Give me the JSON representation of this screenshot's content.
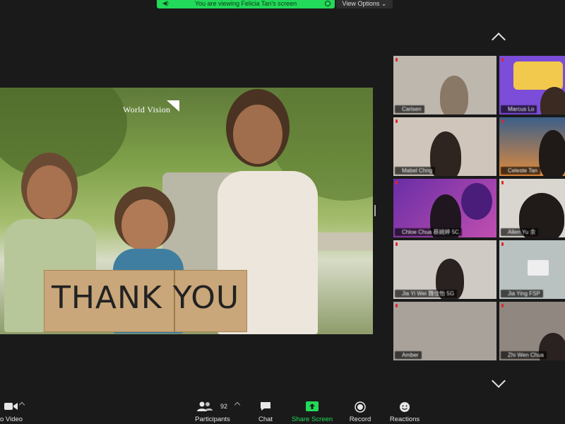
{
  "banner": {
    "text": "You are viewing Felicia Tan's screen",
    "options_label": "View Options"
  },
  "shared_screen": {
    "logo_text": "World Vision",
    "sign_text": "THANK YOU"
  },
  "gallery": {
    "tiles": [
      {
        "name": "Carisen"
      },
      {
        "name": "Marcus Lo"
      },
      {
        "name": "Mabel Chng"
      },
      {
        "name": "Celeste Tan"
      },
      {
        "name": "Chloe Chua 蔡婉婷 5C"
      },
      {
        "name": "Allen Yu 余"
      },
      {
        "name": "Jia Yi Wei 魏佳怡 5G"
      },
      {
        "name": "Jia Ying FSP"
      },
      {
        "name": "Amber"
      },
      {
        "name": "Zhi Wen Chua"
      }
    ]
  },
  "toolbar": {
    "video_label": "o Video",
    "participants_label": "Participants",
    "participants_count": "92",
    "chat_label": "Chat",
    "share_label": "Share Screen",
    "record_label": "Record",
    "reactions_label": "Reactions"
  },
  "colors": {
    "share_green": "#23d959",
    "mic_muted": "#e02828",
    "background": "#1a1a1a"
  }
}
